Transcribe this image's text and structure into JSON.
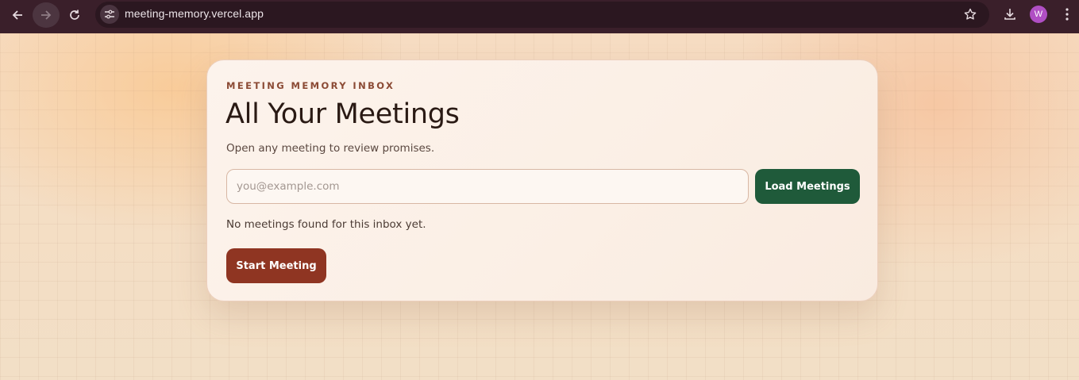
{
  "browser": {
    "url": "meeting-memory.vercel.app",
    "profile_initial": "W",
    "icons": {
      "back": "arrow-left-icon",
      "forward": "arrow-right-icon",
      "reload": "reload-icon",
      "site_info": "tune-icon",
      "bookmark": "star-icon",
      "download": "download-icon",
      "menu": "more-vertical-icon"
    }
  },
  "card": {
    "eyebrow": "MEETING MEMORY INBOX",
    "title": "All Your Meetings",
    "subtitle": "Open any meeting to review promises.",
    "email_input": {
      "value": "",
      "placeholder": "you@example.com"
    },
    "load_button": "Load Meetings",
    "empty_message": "No meetings found for this inbox yet.",
    "start_button": "Start Meeting"
  },
  "colors": {
    "load_button": "#1f5a3a",
    "start_button": "#8f3522",
    "eyebrow": "#8b4a34",
    "chrome_bg": "#3a1f2a",
    "avatar": "#b04fc4"
  }
}
